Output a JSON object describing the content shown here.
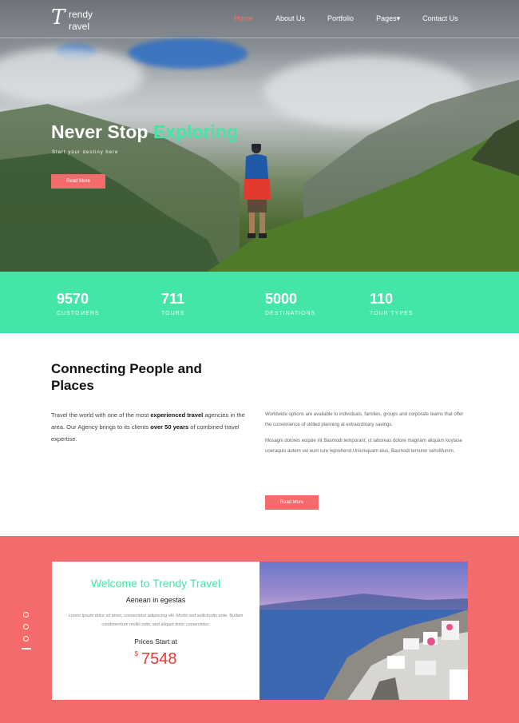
{
  "brand": {
    "logo_mark": "T",
    "line1": "rendy",
    "line2": "ravel"
  },
  "nav": {
    "items": [
      {
        "label": "Home",
        "active": true
      },
      {
        "label": "About Us",
        "active": false
      },
      {
        "label": "Portfolio",
        "active": false
      },
      {
        "label": "Pages▾",
        "active": false
      },
      {
        "label": "Contact Us",
        "active": false
      }
    ]
  },
  "hero": {
    "title_main": "Never Stop ",
    "title_accent": "Exploring",
    "subtitle": "Start your destiny here",
    "button": "Read More"
  },
  "stats": [
    {
      "value": "9570",
      "label": "CUSTOMERS"
    },
    {
      "value": "711",
      "label": "TOURS"
    },
    {
      "value": "5000",
      "label": "DESTINATIONS"
    },
    {
      "value": "110",
      "label": "TOUR TYPES"
    }
  ],
  "about": {
    "title": "Connecting People and Places",
    "left_p1": "Travel the world with one of the most ",
    "left_b1": "experienced travel",
    "left_p2": " agencies in the area. Our Agency brings to its clients ",
    "left_b2": "over 50 years",
    "left_p3": " of combined travel expertise.",
    "right_p1": "Worldwide options are available to individuals, families, groups and corporate teams that offer the convenience of skilled planning at extraordinary savings.",
    "right_p2": "Mosagni dolores eoquie int Basmodi temporant, ut laboreas dolore magnam aliquam kuytase uoeraquis autem vel eum iure reprehend.Unicmquam eius, Basmodi temurer sehsMunim.",
    "button": "Read More"
  },
  "promo": {
    "title": "Welcome to Trendy Travel",
    "subtitle": "Aenean in egestas",
    "description": "Lorem ipsum dolor sit amet, consectetur adipiscing elit. Morbi sed sollicitudin ante. Nullam condimentum mollis odio, sed aliquet dolor consectetur.",
    "price_label": "Prices Start at",
    "currency": "$",
    "price": "7548"
  },
  "colors": {
    "accent_green": "#43e6a6",
    "accent_coral": "#f56a6a",
    "price_red": "#e8382f"
  }
}
